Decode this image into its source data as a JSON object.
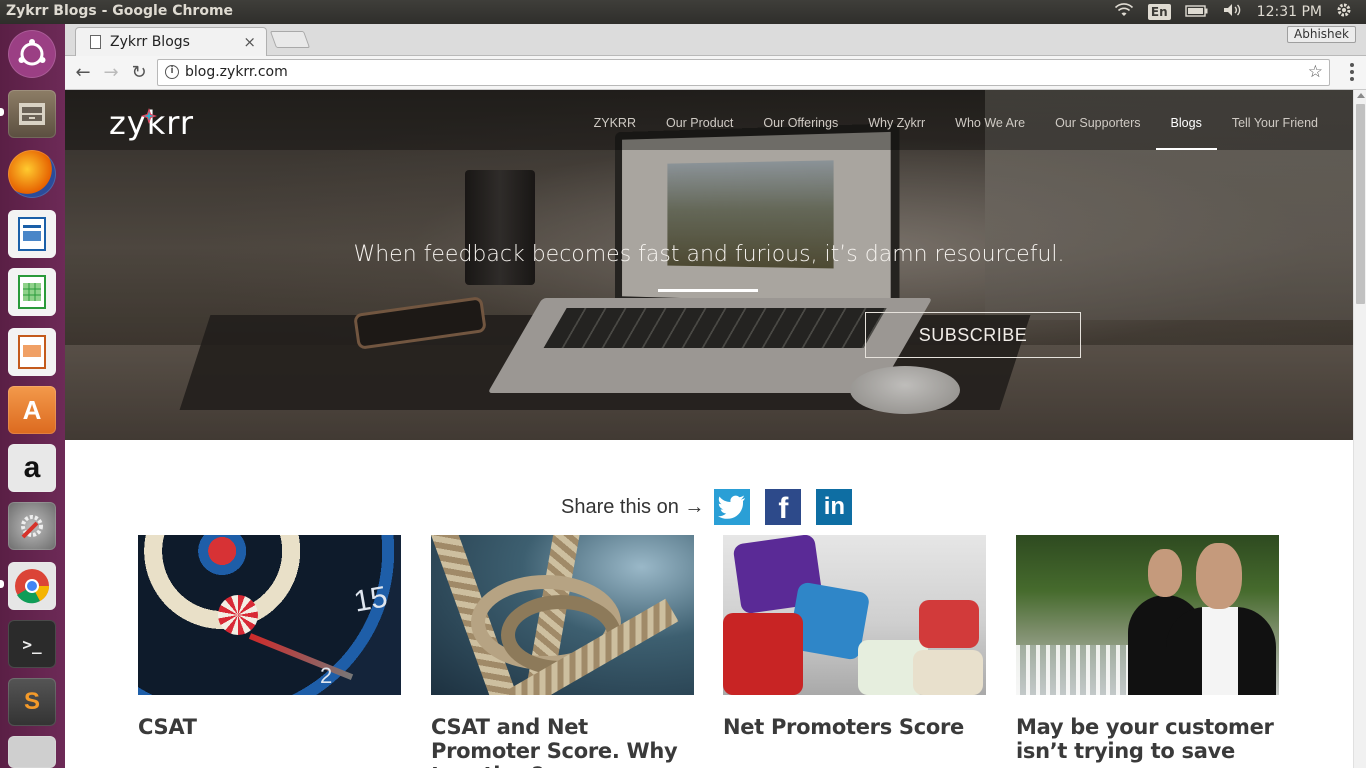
{
  "os": {
    "window_title": "Zykrr Blogs - Google Chrome",
    "keyboard_layout": "En",
    "clock": "12:31 PM",
    "tray_icons": [
      "wifi-icon",
      "keyboard-icon",
      "battery-icon",
      "volume-icon",
      "settings-gear-icon"
    ]
  },
  "launcher": {
    "apps": [
      {
        "name": "ubuntu-dash",
        "color": "#8e3a78"
      },
      {
        "name": "files",
        "color": "#7a6a55"
      },
      {
        "name": "firefox",
        "color": "#e66000"
      },
      {
        "name": "libreoffice-writer",
        "color": "#1a5fa8"
      },
      {
        "name": "libreoffice-calc",
        "color": "#2a9a3a"
      },
      {
        "name": "libreoffice-impress",
        "color": "#c45a1c"
      },
      {
        "name": "ubuntu-software",
        "color": "#e8742a"
      },
      {
        "name": "amazon",
        "color": "#cfcfcf"
      },
      {
        "name": "system-settings",
        "color": "#8a8a8a"
      },
      {
        "name": "chrome",
        "color": "#f0f0f0"
      },
      {
        "name": "terminal",
        "color": "#2e2e2e"
      },
      {
        "name": "sublime-text",
        "color": "#e89a2a"
      },
      {
        "name": "drive",
        "color": "#cfcfcf"
      }
    ]
  },
  "browser": {
    "tab_title": "Zykrr Blogs",
    "tab_close": "×",
    "profile_name": "Abhishek",
    "url": "blog.zykrr.com",
    "back": "←",
    "forward": "→",
    "reload": "↻",
    "bookmark_star": "☆"
  },
  "site": {
    "logo": "zykrr",
    "nav": [
      {
        "label": "ZYKRR",
        "active": false
      },
      {
        "label": "Our Product",
        "active": false
      },
      {
        "label": "Our Offerings",
        "active": false
      },
      {
        "label": "Why Zykrr",
        "active": false
      },
      {
        "label": "Who We Are",
        "active": false
      },
      {
        "label": "Our Supporters",
        "active": false
      },
      {
        "label": "Blogs",
        "active": true
      },
      {
        "label": "Tell Your Friend",
        "active": false
      }
    ],
    "tagline": "When feedback becomes fast and furious, it’s damn resourceful.",
    "subscribe_label": "SUBSCRIBE",
    "share_label": "Share this on →",
    "share_icons": [
      "twitter-icon",
      "facebook-icon",
      "linkedin-icon"
    ],
    "posts": [
      {
        "title": "CSAT",
        "image": "dartboard-image"
      },
      {
        "title": "CSAT and Net Promoter Score. Why together?",
        "image": "rope-knot-image"
      },
      {
        "title": "Net Promoters Score",
        "image": "dice-image"
      },
      {
        "title": "May be your customer isn’t trying to save",
        "image": "waiters-image"
      }
    ]
  }
}
